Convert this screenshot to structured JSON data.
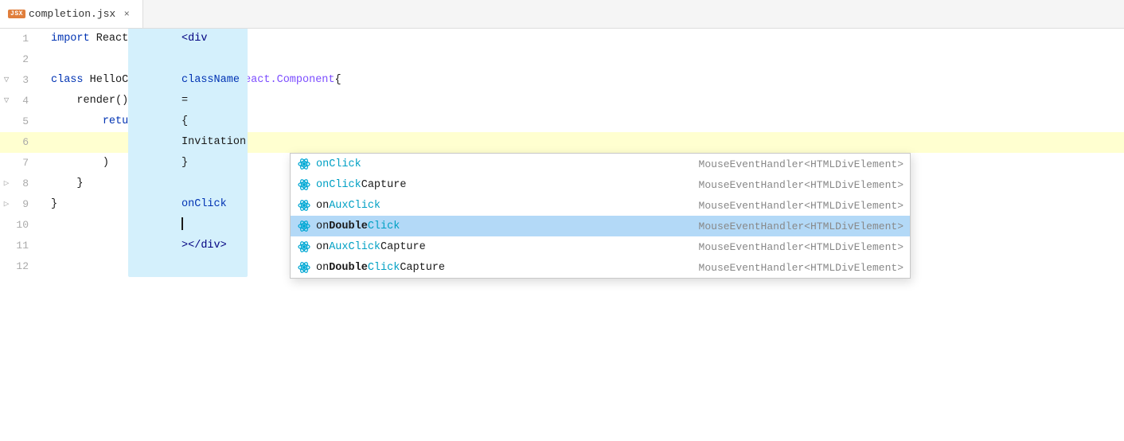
{
  "tab": {
    "icon_label": "JSX",
    "filename": "completion.jsx",
    "close_label": "×"
  },
  "editor": {
    "lines": [
      {
        "num": 1,
        "fold": null,
        "content": "import React from 'react';"
      },
      {
        "num": 2,
        "fold": null,
        "content": ""
      },
      {
        "num": 3,
        "fold": "class",
        "content": "class HelloComponent extends React.Component{"
      },
      {
        "num": 4,
        "fold": "render",
        "content": "    render(){"
      },
      {
        "num": 5,
        "fold": null,
        "content": "        return ("
      },
      {
        "num": 6,
        "fold": null,
        "content": "            <div className={Invitation} onClick></div>",
        "highlighted": true
      },
      {
        "num": 7,
        "fold": null,
        "content": "        )"
      },
      {
        "num": 8,
        "fold": "brace",
        "content": "    }"
      },
      {
        "num": 9,
        "fold": "brace",
        "content": "}"
      },
      {
        "num": 10,
        "fold": null,
        "content": ""
      },
      {
        "num": 11,
        "fold": null,
        "content": ""
      },
      {
        "num": 12,
        "fold": null,
        "content": ""
      }
    ]
  },
  "autocomplete": {
    "items": [
      {
        "label_prefix": "on",
        "label_match": "Click",
        "label_suffix": "",
        "type": "MouseEventHandler<HTMLDivElement>"
      },
      {
        "label_prefix": "on",
        "label_match": "Click",
        "label_suffix": "Capture",
        "type": "MouseEventHandler<HTMLDivElement>"
      },
      {
        "label_prefix": "on",
        "label_match": "Aux",
        "label_match2": "Click",
        "label_suffix": "",
        "display": "onAuxClick",
        "type": "MouseEventHandler<HTMLDivElement>"
      },
      {
        "label_prefix": "on",
        "label_bold": "Double",
        "label_match": "Click",
        "label_suffix": "",
        "display": "onDoubleClick",
        "type": "MouseEventHandler<HTMLDivElement>",
        "selected": true
      },
      {
        "label_prefix": "on",
        "label_match": "Aux",
        "label_match2": "Click",
        "label_suffix": "Capture",
        "display": "onAuxClickCapture",
        "type": "MouseEventHandler<HTMLDivElement>"
      },
      {
        "label_prefix": "on",
        "label_bold": "Double",
        "label_match": "Click",
        "label_suffix": "Capture",
        "display": "onDoubleClickCapture",
        "type": "MouseEventHandler<HTMLDivElement>"
      }
    ]
  }
}
